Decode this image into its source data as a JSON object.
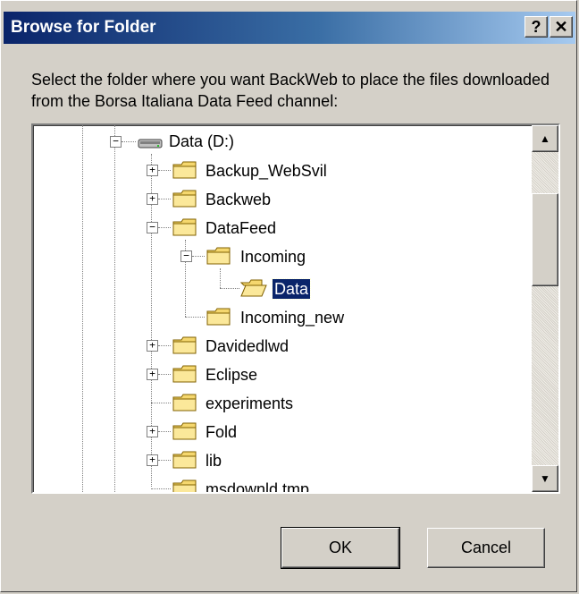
{
  "window": {
    "title": "Browse for Folder",
    "help_label": "?",
    "close_label": "✕"
  },
  "instructions": "Select the folder where you want BackWeb to place the files downloaded from the Borsa Italiana Data Feed channel:",
  "tree": {
    "items": [
      {
        "label": "Data (D:)",
        "icon": "drive-icon",
        "expander": "−"
      },
      {
        "label": "Backup_WebSvil",
        "icon": "folder-icon",
        "expander": "+"
      },
      {
        "label": "Backweb",
        "icon": "folder-icon",
        "expander": "+"
      },
      {
        "label": "DataFeed",
        "icon": "folder-icon",
        "expander": "−"
      },
      {
        "label": "Incoming",
        "icon": "folder-icon",
        "expander": "−"
      },
      {
        "label": "Data",
        "icon": "open-folder-icon",
        "selected": true
      },
      {
        "label": "Incoming_new",
        "icon": "folder-icon"
      },
      {
        "label": "Davidedlwd",
        "icon": "folder-icon",
        "expander": "+"
      },
      {
        "label": "Eclipse",
        "icon": "folder-icon",
        "expander": "+"
      },
      {
        "label": "experiments",
        "icon": "folder-icon"
      },
      {
        "label": "Fold",
        "icon": "folder-icon",
        "expander": "+"
      },
      {
        "label": "lib",
        "icon": "folder-icon",
        "expander": "+"
      },
      {
        "label": "msdownld.tmp",
        "icon": "folder-icon"
      }
    ]
  },
  "scrollbar": {
    "up_arrow": "▲",
    "down_arrow": "▼"
  },
  "buttons": {
    "ok": "OK",
    "cancel": "Cancel"
  },
  "colors": {
    "title_start": "#0a246a",
    "title_end": "#a6caf0",
    "selection": "#0a246a",
    "folder": "#f5d76e"
  }
}
